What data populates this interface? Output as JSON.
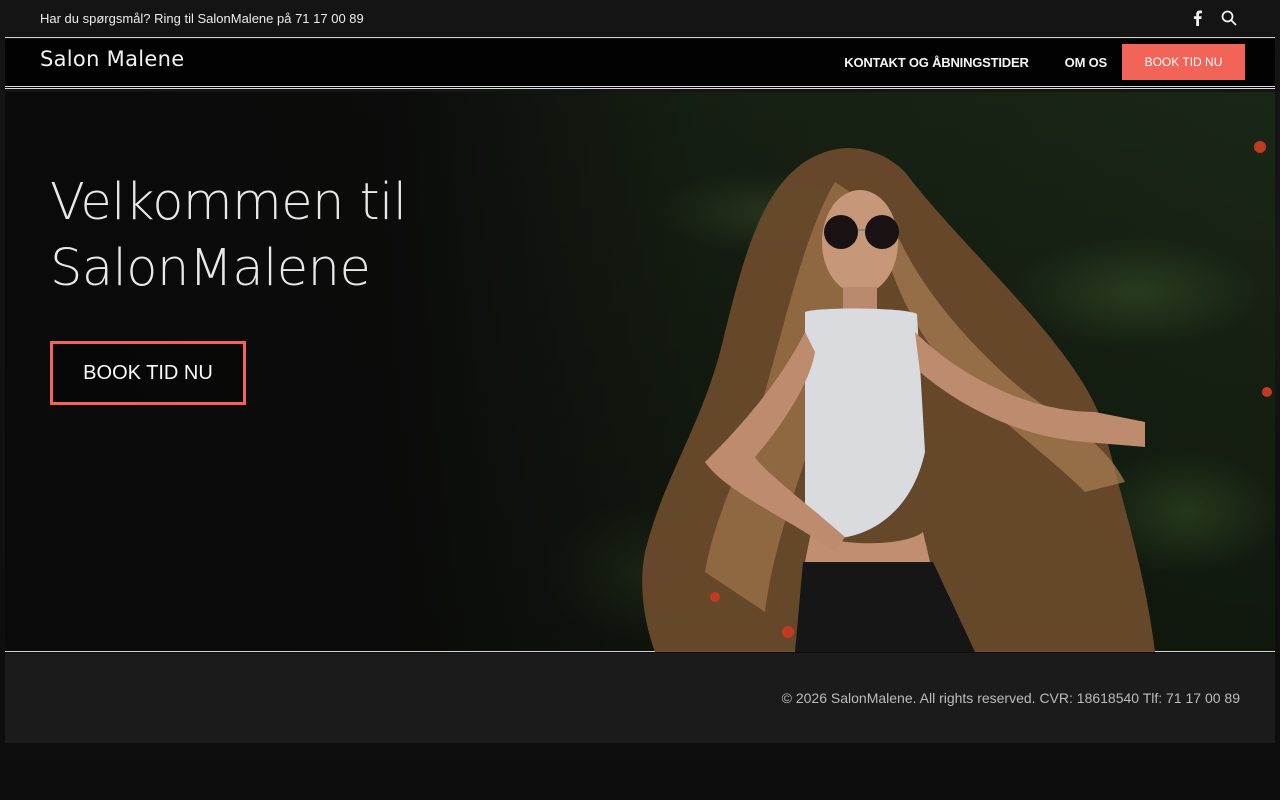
{
  "topbar": {
    "contact_text": "Har du spørgsmål? Ring til SalonMalene på 71 17 00 89",
    "icons": [
      "facebook-icon",
      "search-icon"
    ]
  },
  "nav": {
    "logo": "Salon Malene",
    "links": [
      "KONTAKT OG ÅBNINGSTIDER",
      "OM OS"
    ],
    "book_label": "BOOK TID NU"
  },
  "hero": {
    "title_line1": "Velkommen til",
    "title_line2": "SalonMalene",
    "book_label": "BOOK TID NU"
  },
  "footer": {
    "copyright": "© 2026 SalonMalene. All rights reserved. CVR: 18618540 Tlf: 71 17 00 89"
  },
  "colors": {
    "accent": "#f26457",
    "dark": "#0b0b0b",
    "footer_bg": "#1b1b1b"
  }
}
